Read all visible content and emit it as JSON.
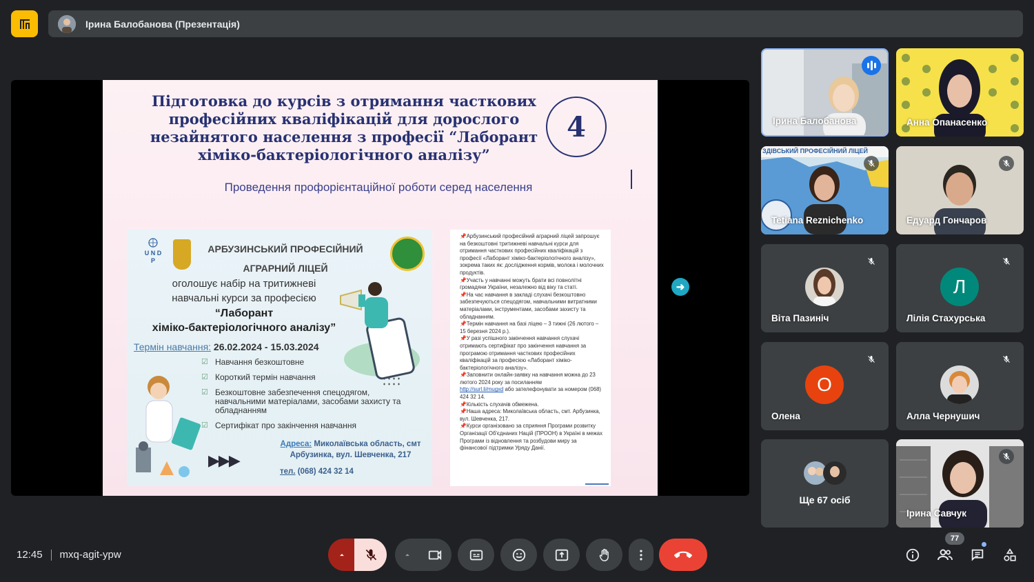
{
  "header": {
    "presenter_title": "Ірина Балобанова (Презентація)"
  },
  "slide": {
    "title": "Підготовка до курсів з отримання часткових професійних кваліфікацій для дорослого незайнятого населення з професії “Лаборант хіміко-бактеріологічного аналізу”",
    "number": "4",
    "subtitle": "Проведення профорієнтаційної роботи серед населення",
    "poster": {
      "undp": "U N D P",
      "school_line1": "АРБУЗИНСЬКИЙ ПРОФЕСІЙНИЙ",
      "school_line2": "АГРАРНИЙ ЛІЦЕЙ",
      "announce_line1": "оголошує набір на тритижневі",
      "announce_line2": "навчальні курси за професією",
      "profession_line1": "“Лаборант",
      "profession_line2": "хіміко-бактеріологічного аналізу”",
      "term_label": "Термін навчання:",
      "term_value": " 26.02.2024 - 15.03.2024",
      "benefits": [
        "Навчання безкоштовне",
        "Короткий термін навчання",
        "Безкоштовне забезпечення спецодягом, навчальними  матеріалами, засобами захисту та обладнанням",
        "Сертифікат про закінчення навчання"
      ],
      "address_label": "Адреса:",
      "address_value": " Миколаївська область, смт Арбузинка, вул. Шевченка, 217",
      "tel_label": "тел.",
      "tel_value": " (068) 424 32 14"
    },
    "doc": {
      "paragraphs": [
        "📌Арбузинський професійний аграрний ліцей запрошує на безкоштовні тритижневі навчальні курси для отримання часткових професійних кваліфікацій з професії «Лаборант хіміко-бактеріологічного аналізу», зокрема таких як: дослідження кормів, молока і молочних продуктів.",
        "📌Участь у навчанні можуть брати всі повнолітні громадяни України, незалежно від віку та статі.",
        "📌На час навчання в закладі слухачі безкоштовно забезпечуються спецодягом, навчальними витратними матеріалами, інструментами, засобами захисту та обладнанням.",
        "📌Термін навчання на базі ліцею – 3 тижні (26 лютого – 15 березня 2024 р.).",
        "📌У разі успішного закінчення навчання слухачі отримають сертифікат про закінчення навчання за програмою отримання часткових професійних кваліфікацій за професією «Лаборант хіміко-бактеріологічного аналізу».",
        "📌Заповнити онлайн-заявку на навчання можна до 23 лютого 2024 року за посиланням"
      ],
      "link": "http://surl.li/mugxd",
      "link_tail": " або зателефонувати за номером (068) 424 32 14.",
      "tail_paragraphs": [
        "📌Кількість слухачів обмежена.",
        "📌Наша адреса: Миколаївська область, смт. Арбузинка, вул. Шевченка, 217.",
        "📌Курси організовано за сприяння Програми розвитку Організації Об'єднаних Націй (ПРООН) в Україні в межах Програми із відновлення та розбудови миру за фінансової підтримки Уряду Данії."
      ]
    }
  },
  "participants": [
    {
      "name": "Ірина Балобанова"
    },
    {
      "name": "Анна Опанасенко"
    },
    {
      "name": "Tetiana Reznichenko",
      "banner": "ЗДІВСЬКИЙ ПРОФЕСІЙНИЙ ЛІЦЕЙ"
    },
    {
      "name": "Едуард Гончаров"
    },
    {
      "name": "Віта Пазиніч"
    },
    {
      "name": "Лілія Стахурська",
      "initial": "Л",
      "color": "#00897b"
    },
    {
      "name": "Олена",
      "initial": "О",
      "color": "#e8430e"
    },
    {
      "name": "Алла Чернушич"
    },
    {
      "name": "Ще 67 осіб"
    },
    {
      "name": "Ірина Савчук"
    }
  ],
  "footer": {
    "time": "12:45",
    "meeting_code": "mxq-agit-ypw",
    "participants_count": "77"
  },
  "colors": {
    "accent_yellow": "#fbbc04",
    "end_call": "#ea4335",
    "mic_muted_bg": "#f9dedc",
    "slide_navy": "#283272"
  }
}
